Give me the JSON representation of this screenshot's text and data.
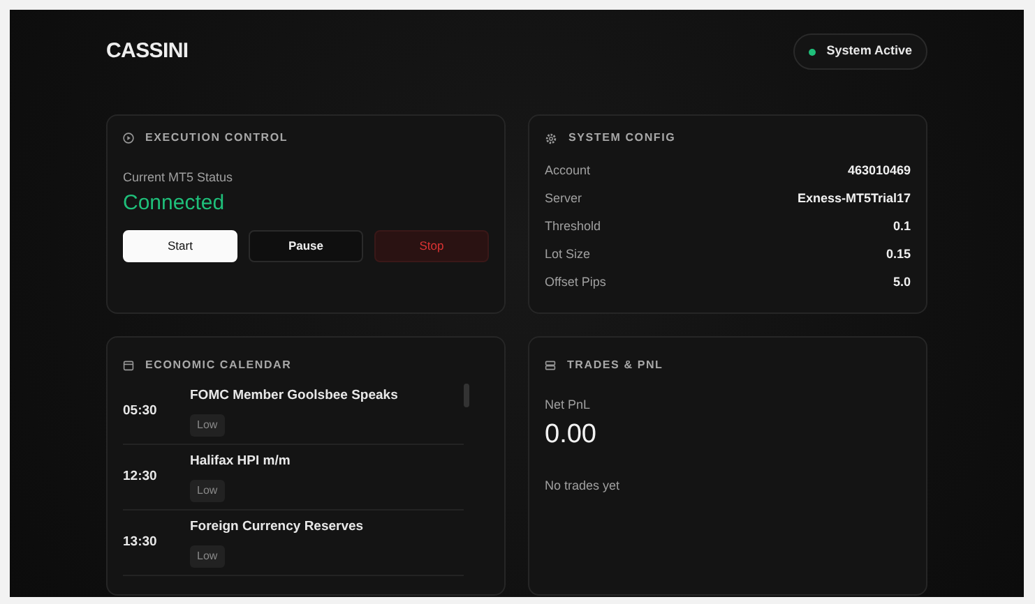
{
  "brand": "CASSINI",
  "system_status": {
    "label": "System Active",
    "active": true
  },
  "execution_control": {
    "title": "EXECUTION CONTROL",
    "status_label": "Current MT5 Status",
    "status": "Connected",
    "connected": true,
    "buttons": [
      {
        "label": "Start",
        "kind": "primary"
      },
      {
        "label": "Pause",
        "kind": "secondary"
      },
      {
        "label": "Stop",
        "kind": "danger"
      }
    ]
  },
  "system_config": {
    "title": "SYSTEM CONFIG",
    "rows": [
      {
        "label": "Account",
        "value": "463010469"
      },
      {
        "label": "Server",
        "value": "Exness-MT5Trial17"
      },
      {
        "label": "Threshold",
        "value": "0.1"
      },
      {
        "label": "Lot Size",
        "value": "0.15"
      },
      {
        "label": "Offset Pips",
        "value": "5.0"
      }
    ]
  },
  "economic_calendar": {
    "title": "ECONOMIC CALENDAR",
    "events": [
      {
        "time": "05:30",
        "name": "FOMC Member Goolsbee Speaks",
        "impact": "Low"
      },
      {
        "time": "12:30",
        "name": "Halifax HPI m/m",
        "impact": "Low"
      },
      {
        "time": "13:30",
        "name": "Foreign Currency Reserves",
        "impact": "Low"
      }
    ]
  },
  "trades": {
    "title": "TRADES & PNL",
    "pnl_label": "Net PnL",
    "pnl": "0.00",
    "empty_text": "No trades yet"
  }
}
